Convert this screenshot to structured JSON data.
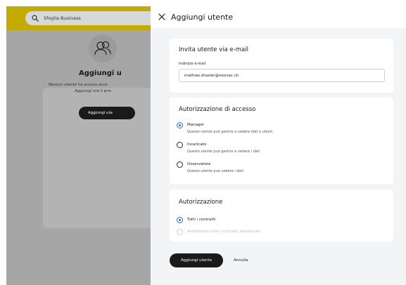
{
  "background": {
    "search_placeholder": "Sfoglia Business",
    "search_icon": "search-icon",
    "empty_state": {
      "icon": "users-icon",
      "title": "Aggiungi u",
      "description_line1": "Nessun utente ha ancora acce",
      "description_line2": "Aggiungi ora il prin",
      "button_label": "Aggiungi ute"
    }
  },
  "drawer": {
    "title": "Aggiungi utente",
    "close_icon": "close-icon",
    "invite_section": {
      "title": "Invita utente via e-mail",
      "email_label": "Indirizzo e-mail",
      "email_value": "mathias.draxler@neovac.ch"
    },
    "access_section": {
      "title": "Autorizzazione di accesso",
      "options": [
        {
          "label": "Manager",
          "description": "Questo utente può gestire e vedere dati e utenti.",
          "selected": true
        },
        {
          "label": "Incaricato",
          "description": "Questo utente può gestire e vedere i dati",
          "selected": false
        },
        {
          "label": "Osservatore",
          "description": "Questo utente può vedere i dati",
          "selected": false
        }
      ]
    },
    "authorization_section": {
      "title": "Autorizzazione",
      "options": [
        {
          "label": "Tutti i contratti",
          "selected": true,
          "disabled": false
        },
        {
          "label": "Autorizzare solo i contratti selezionati",
          "selected": false,
          "disabled": true
        }
      ]
    },
    "actions": {
      "submit_label": "Aggiungi utente",
      "cancel_label": "Annulla"
    }
  },
  "colors": {
    "top_bar": "#c3ab00",
    "overlay": "#a6a6a6",
    "radio_accent": "#1976d2",
    "primary_button": "#1a1a1a"
  }
}
